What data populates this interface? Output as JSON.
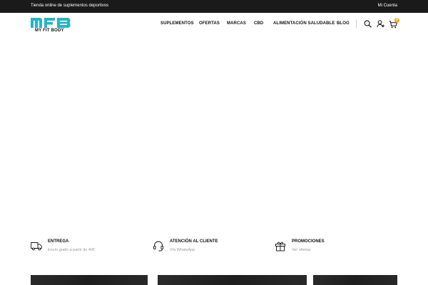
{
  "topbar": {
    "tagline": "Tienda online de suplementos deportivos",
    "account_link": "Mi Cuenta"
  },
  "brand": {
    "logo_text": "MFB",
    "name": "MY FIT BODY",
    "color": "#2bb3c0"
  },
  "nav": {
    "items": [
      {
        "label": "SUPLEMENTOS"
      },
      {
        "label": "OFERTAS"
      },
      {
        "label": "MARCAS"
      },
      {
        "label": "CBD"
      },
      {
        "label": "ALIMENTACIÓN SALUDABLE"
      },
      {
        "label": "BLOG"
      }
    ]
  },
  "header_icons": {
    "search": "search-icon",
    "account": "user-plus-icon",
    "cart": "cart-icon",
    "cart_count": "0",
    "badge_color": "#f4a81d"
  },
  "features": [
    {
      "icon": "truck-icon",
      "title": "ENTREGA",
      "subtitle": "Envío gratis a partir de 40€"
    },
    {
      "icon": "headset-icon",
      "title": "ATENCIÓN AL CLIENTE",
      "subtitle": "Vía WhatsApp"
    },
    {
      "icon": "gift-icon",
      "title": "PROMOCIONES",
      "subtitle": "Ver ofertas"
    }
  ]
}
